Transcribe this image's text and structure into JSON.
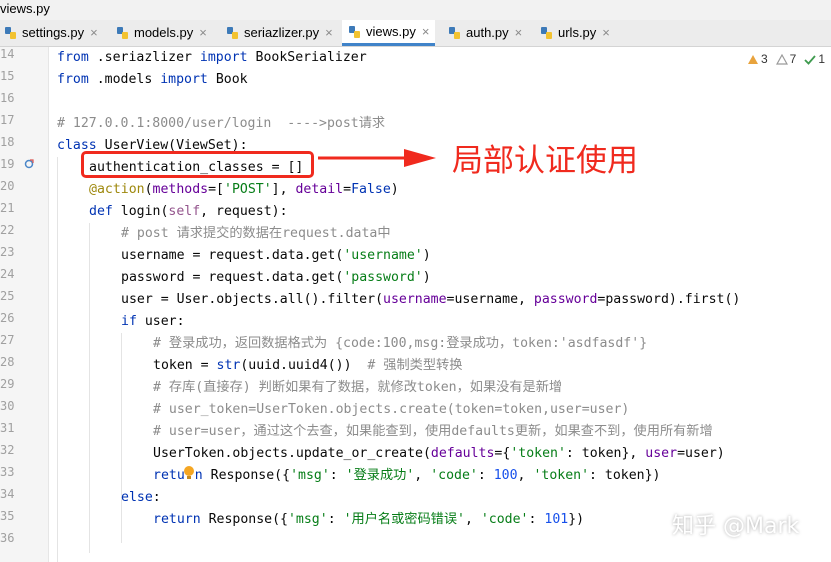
{
  "window": {
    "title": "views.py"
  },
  "tabs": [
    {
      "label": "settings.py",
      "active": false
    },
    {
      "label": "models.py",
      "active": false
    },
    {
      "label": "seriazlizer.py",
      "active": false
    },
    {
      "label": "views.py",
      "active": true
    },
    {
      "label": "auth.py",
      "active": false
    },
    {
      "label": "urls.py",
      "active": false
    }
  ],
  "tab_close_glyph": "×",
  "inspection": {
    "warnings": "3",
    "weak_warnings": "7",
    "ok": "1"
  },
  "line_numbers": [
    "14",
    "15",
    "16",
    "17",
    "18",
    "19",
    "20",
    "21",
    "22",
    "23",
    "24",
    "25",
    "26",
    "27",
    "28",
    "29",
    "30",
    "31",
    "32",
    "33",
    "34",
    "35",
    "36"
  ],
  "code": {
    "l14": {
      "kw1": "from",
      "mod": " .seriazlizer ",
      "kw2": "import",
      "name": " BookSerializer"
    },
    "l15": {
      "kw1": "from",
      "mod": " .models ",
      "kw2": "import",
      "name": " Book"
    },
    "l17": {
      "comment": "# 127.0.0.1:8000/user/login  ---->post请求"
    },
    "l18": {
      "kw": "class",
      "rest": " UserView(ViewSet):"
    },
    "l19": {
      "text": "authentication_classes = []"
    },
    "l20": {
      "dec": "@action",
      "p1": "(",
      "prm1": "methods",
      "p2": "=[",
      "str": "'POST'",
      "p3": "], ",
      "prm2": "detail",
      "p4": "=",
      "kw": "False",
      "p5": ")"
    },
    "l21": {
      "kw": "def",
      "name": " login(",
      "slf": "self",
      "rest": ", request):"
    },
    "l22": {
      "comment": "# post 请求提交的数据在request.data中"
    },
    "l23": {
      "a": "username = request.data.get(",
      "str": "'username'",
      "b": ")"
    },
    "l24": {
      "a": "password = request.data.get(",
      "str": "'password'",
      "b": ")"
    },
    "l25": {
      "a": "user = User.objects.all().filter(",
      "prm1": "username",
      "b": "=username, ",
      "prm2": "password",
      "c": "=password).first()"
    },
    "l26": {
      "kw": "if",
      "rest": " user:"
    },
    "l27": {
      "comment": "# 登录成功，返回数据格式为 {code:100,msg:登录成功，token:'asdfasdf'}"
    },
    "l28": {
      "a": "token = ",
      "kw": "str",
      "b": "(uuid.uuid4())  ",
      "comment": "# 强制类型转换"
    },
    "l29": {
      "comment": "# 存库(直接存) 判断如果有了数据，就修改token，如果没有是新增"
    },
    "l30": {
      "comment": "# user_token=UserToken.objects.create(token=token,user=user)"
    },
    "l31": {
      "comment": "# user=user，通过这个去查，如果能查到，使用defaults更新，如果查不到，使用所有新增"
    },
    "l32": {
      "a": "UserToken.objects.update_or_create(",
      "prm1": "defaults",
      "b": "={",
      "str": "'token'",
      "c": ": token}, ",
      "prm2": "user",
      "d": "=user)"
    },
    "l33": {
      "kw": "retu",
      "kw2": "n",
      "a": " Response({",
      "s1": "'msg'",
      "b": ": ",
      "s2": "'登录成功'",
      "c": ", ",
      "s3": "'code'",
      "d": ": ",
      "n1": "100",
      "e": ", ",
      "s4": "'token'",
      "f": ": token})"
    },
    "l34": {
      "kw": "else",
      "rest": ":"
    },
    "l35": {
      "kw": "return",
      "a": " Response({",
      "s1": "'msg'",
      "b": ": ",
      "s2": "'用户名或密码错误'",
      "c": ", ",
      "s3": "'code'",
      "d": ": ",
      "n1": "101",
      "e": "})"
    }
  },
  "annotation": {
    "text": "局部认证使用",
    "color": "#f02a1e"
  },
  "watermark": {
    "text": "知乎 @Mark"
  },
  "colors": {
    "keyword": "#0033b3",
    "string": "#067d17",
    "comment": "#8c8c8c",
    "decorator": "#9e880d",
    "param": "#660099",
    "number": "#1750eb",
    "tab_active_underline": "#4083c9"
  }
}
